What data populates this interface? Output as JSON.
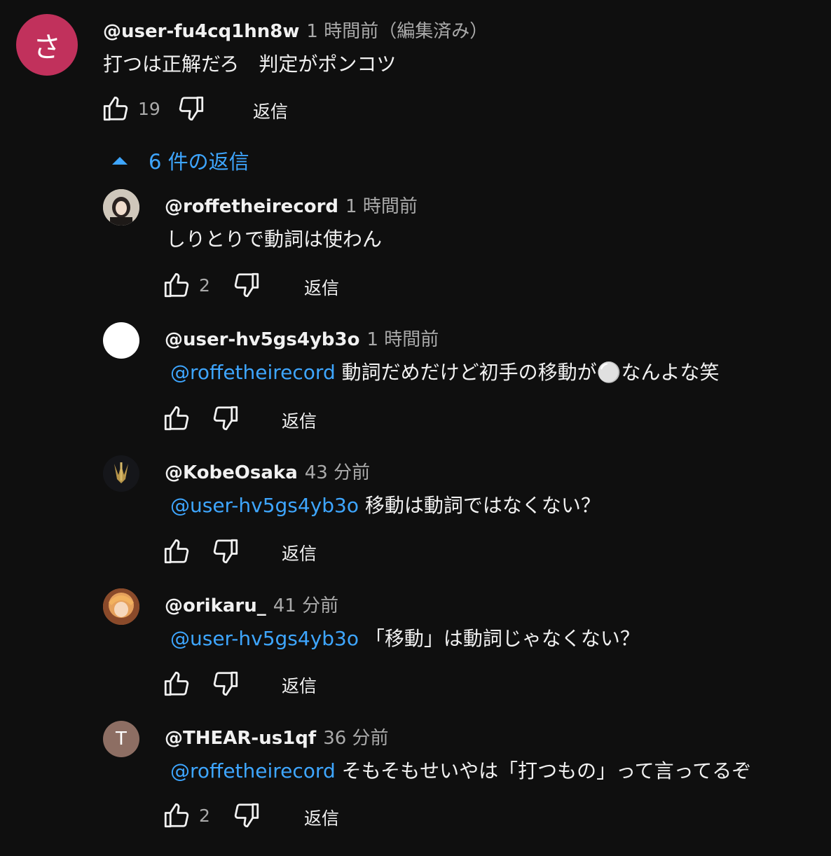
{
  "top_comment": {
    "avatar_letter": "さ",
    "avatar_color": "#c1315c",
    "handle": "@user-fu4cq1hn8w",
    "time": "1 時間前（編集済み）",
    "text": "打つは正解だろ　判定がポンコツ",
    "likes": "19",
    "reply_label": "返信"
  },
  "replies_toggle": {
    "label": "6 件の返信",
    "icon": "caret-up-icon"
  },
  "replies": [
    {
      "handle": "@roffetheirecord",
      "time": "1 時間前",
      "mention": "",
      "text": "しりとりで動詞は使わん",
      "likes": "2",
      "reply_label": "返信"
    },
    {
      "handle": "@user-hv5gs4yb3o",
      "time": "1 時間前",
      "mention": "@roffetheirecord",
      "text": "動詞だめだけど初手の移動が⚪️なんよな笑",
      "likes": "",
      "reply_label": "返信"
    },
    {
      "handle": "@KobeOsaka",
      "time": "43 分前",
      "mention": "@user-hv5gs4yb3o",
      "text": "移動は動詞ではなくない？",
      "likes": "",
      "reply_label": "返信"
    },
    {
      "handle": "@orikaru_",
      "time": "41 分前",
      "mention": "@user-hv5gs4yb3o",
      "text": "「移動」は動詞じゃなくない？",
      "likes": "",
      "reply_label": "返信"
    },
    {
      "handle": "@THEAR-us1qf",
      "time": "36 分前",
      "mention": "@roffetheirecord",
      "text": "そもそもせいやは「打つもの」って言ってるぞ",
      "likes": "2",
      "reply_label": "返信",
      "avatar_letter": "T",
      "avatar_color": "#8d6e63"
    }
  ],
  "icons": {
    "like": "thumb-up-icon",
    "dislike": "thumb-down-icon"
  }
}
